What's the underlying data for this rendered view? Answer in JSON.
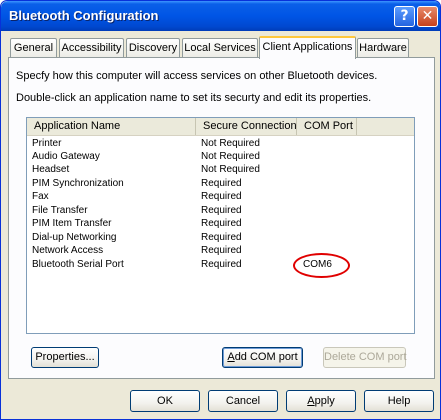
{
  "window": {
    "title": "Bluetooth Configuration",
    "help_glyph": "?",
    "close_glyph": "✕"
  },
  "tabs": [
    {
      "label": "General",
      "active": false
    },
    {
      "label": "Accessibility",
      "active": false
    },
    {
      "label": "Discovery",
      "active": false
    },
    {
      "label": "Local Services",
      "active": false
    },
    {
      "label": "Client Applications",
      "active": true
    },
    {
      "label": "Hardware",
      "active": false
    }
  ],
  "panel": {
    "description_1": "Specfy how this computer will access services on other Bluetooth devices.",
    "description_2": "Double-click an application name to set its securty and edit its properties."
  },
  "list": {
    "columns": [
      "Application Name",
      "Secure Connection",
      "COM Port"
    ],
    "rows": [
      {
        "name": "Printer",
        "secure": "Not Required",
        "com": ""
      },
      {
        "name": "Audio Gateway",
        "secure": "Not Required",
        "com": ""
      },
      {
        "name": "Headset",
        "secure": "Not Required",
        "com": ""
      },
      {
        "name": "PIM Synchronization",
        "secure": "Required",
        "com": ""
      },
      {
        "name": "Fax",
        "secure": "Required",
        "com": ""
      },
      {
        "name": "File Transfer",
        "secure": "Required",
        "com": ""
      },
      {
        "name": "PIM Item Transfer",
        "secure": "Required",
        "com": ""
      },
      {
        "name": "Dial-up Networking",
        "secure": "Required",
        "com": ""
      },
      {
        "name": "Network Access",
        "secure": "Required",
        "com": ""
      },
      {
        "name": "Bluetooth Serial Port",
        "secure": "Required",
        "com": "COM6"
      }
    ]
  },
  "panel_buttons": {
    "properties": "Properties...",
    "add_com_prefix": "A",
    "add_com_rest": "dd COM port",
    "delete_com": "Delete COM port"
  },
  "dialog_buttons": {
    "ok": "OK",
    "cancel": "Cancel",
    "apply_prefix": "A",
    "apply_rest": "pply",
    "help": "Help"
  },
  "colors": {
    "title_bar": "#0055e5",
    "annotation": "#e00000",
    "active_tab_accent": "#ffc83c"
  }
}
